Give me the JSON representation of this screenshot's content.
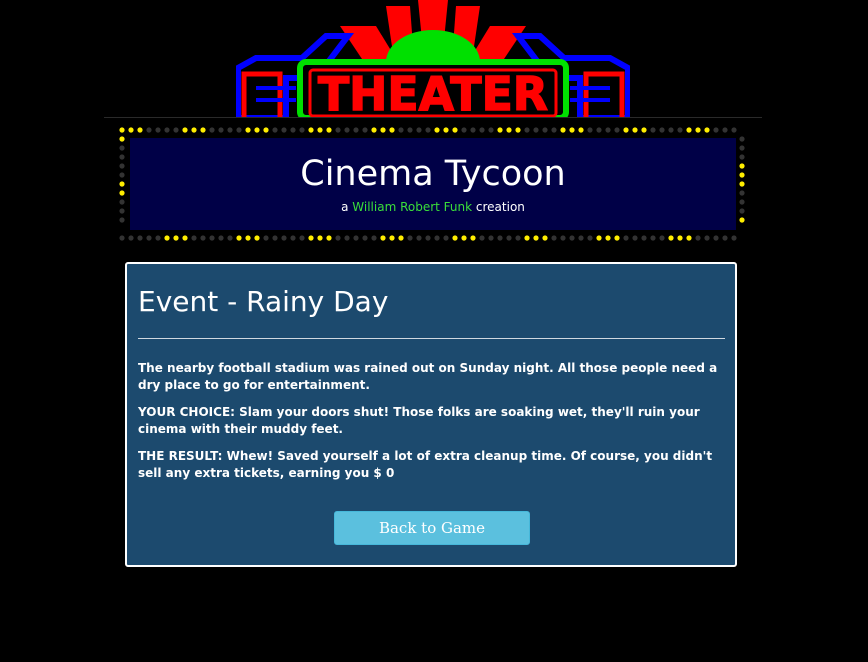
{
  "logo": {
    "sign_text": "THEATER",
    "colors": {
      "red": "#ff0000",
      "green": "#00e000",
      "blue": "#0000ff",
      "sign_fill": "#000000"
    }
  },
  "header": {
    "title": "Cinema Tycoon",
    "byline_prefix": "a",
    "author": "William Robert Funk",
    "byline_suffix": "creation"
  },
  "marquee": {
    "panel_color": "#000047",
    "light_on_color": "#ffee00",
    "light_off_color": "#333333"
  },
  "event": {
    "title": "Event - Rainy Day",
    "description": "The nearby football stadium was rained out on Sunday night. All those people need a dry place to go for entertainment.",
    "choice": "YOUR CHOICE: Slam your doors shut! Those folks are soaking wet, they'll ruin your cinema with their muddy feet.",
    "result": "THE RESULT: Whew! Saved yourself a lot of extra cleanup time. Of course, you didn't sell any extra tickets, earning you $ 0",
    "back_button_label": "Back to Game",
    "box_color": "#1c4a6e",
    "button_color": "#5bc0de"
  }
}
